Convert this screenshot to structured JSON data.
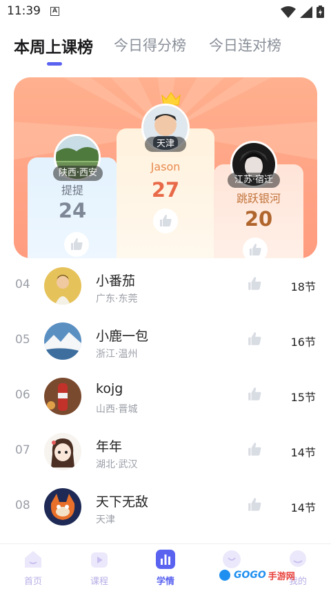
{
  "status": {
    "time": "11:39",
    "notification_letter": "A"
  },
  "tabs": [
    {
      "label": "本周上课榜",
      "active": true
    },
    {
      "label": "今日得分榜",
      "active": false
    },
    {
      "label": "今日连对榜",
      "active": false
    }
  ],
  "podium": {
    "second": {
      "location": "陕西·西安",
      "name": "提提",
      "score": "24"
    },
    "first": {
      "location": "天津",
      "name": "Jason",
      "score": "27"
    },
    "third": {
      "location": "江苏·宿迁",
      "name": "跳跃银河",
      "score": "20"
    }
  },
  "rankings": [
    {
      "rank": "04",
      "name": "小番茄",
      "location": "广东·东莞",
      "count": "18节"
    },
    {
      "rank": "05",
      "name": "小鹿一包",
      "location": "浙江·温州",
      "count": "16节"
    },
    {
      "rank": "06",
      "name": "kojg",
      "location": "山西·晋城",
      "count": "15节"
    },
    {
      "rank": "07",
      "name": "年年",
      "location": "湖北·武汉",
      "count": "14节"
    },
    {
      "rank": "08",
      "name": "天下无敌",
      "location": "天津",
      "count": "14节"
    }
  ],
  "nav": [
    {
      "label": "首页",
      "icon": "home-icon",
      "active": false
    },
    {
      "label": "课程",
      "icon": "course-icon",
      "active": false
    },
    {
      "label": "学情",
      "icon": "stats-icon",
      "active": true
    },
    {
      "label": "",
      "icon": "discover-icon",
      "active": false
    },
    {
      "label": "我的",
      "icon": "profile-icon",
      "active": false
    }
  ],
  "watermark": {
    "text": "GOGO",
    "text2": "手游网"
  },
  "colors": {
    "accent": "#5a63f0",
    "podium_bg": "#ffa486",
    "second_score": "#7d8796",
    "first_score": "#e86a48",
    "third_score": "#b0652c"
  }
}
